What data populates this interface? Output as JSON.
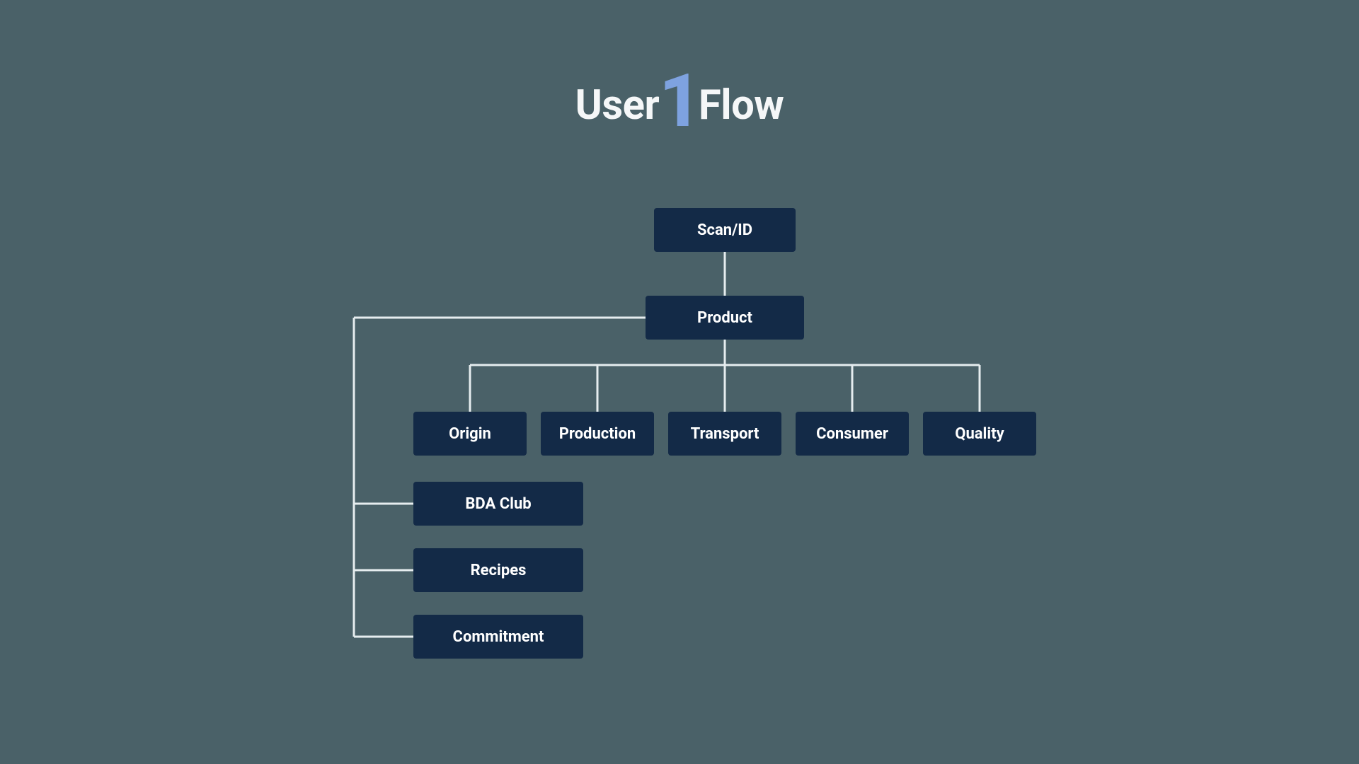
{
  "title": {
    "left": "User",
    "right": "Flow",
    "number": "1"
  },
  "nodes": {
    "root": {
      "label": "Scan/ID"
    },
    "product": {
      "label": "Product"
    },
    "origin": {
      "label": "Origin"
    },
    "production": {
      "label": "Production"
    },
    "transport": {
      "label": "Transport"
    },
    "consumer": {
      "label": "Consumer"
    },
    "quality": {
      "label": "Quality"
    },
    "bdaclub": {
      "label": "BDA Club"
    },
    "recipes": {
      "label": "Recipes"
    },
    "commitment": {
      "label": "Commitment"
    }
  },
  "colors": {
    "bg": "#4a6168",
    "node": "#132a47",
    "line": "#e6edef",
    "accentNumber": "#7ea2e0",
    "titleText": "#f5f7f8"
  }
}
